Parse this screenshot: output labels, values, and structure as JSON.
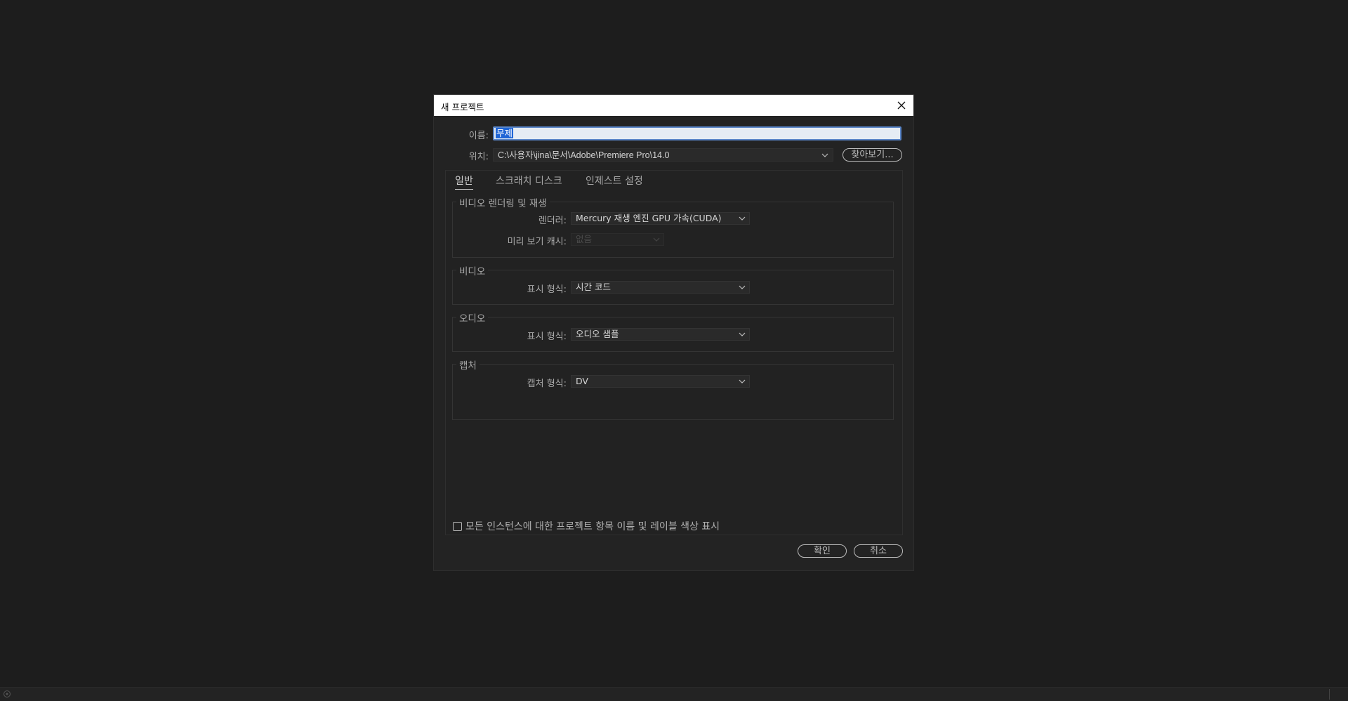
{
  "dialog": {
    "title": "새 프로젝트",
    "name_label": "이름:",
    "name_value": "무제",
    "location_label": "위치:",
    "location_value": "C:\\사용자\\jina\\문서\\Adobe\\Premiere Pro\\14.0",
    "browse_label": "찾아보기...",
    "ok_label": "확인",
    "cancel_label": "취소"
  },
  "tabs": [
    {
      "label": "일반",
      "active": true
    },
    {
      "label": "스크래치 디스크",
      "active": false
    },
    {
      "label": "인제스트 설정",
      "active": false
    }
  ],
  "groups": {
    "rendering": {
      "title": "비디오 렌더링 및 재생",
      "renderer_label": "렌더러:",
      "renderer_value": "Mercury 재생 엔진 GPU 가속(CUDA)",
      "preview_cache_label": "미리 보기 캐시:",
      "preview_cache_value": "없음"
    },
    "video": {
      "title": "비디오",
      "display_format_label": "표시 형식:",
      "display_format_value": "시간 코드"
    },
    "audio": {
      "title": "오디오",
      "display_format_label": "표시 형식:",
      "display_format_value": "오디오 샘플"
    },
    "capture": {
      "title": "캡처",
      "capture_format_label": "캡처 형식:",
      "capture_format_value": "DV"
    }
  },
  "checkbox": {
    "label": "모든 인스턴스에 대한 프로젝트 항목 이름 및 레이블 색상 표시",
    "checked": false
  },
  "colors": {
    "background": "#1d1d1d",
    "dialog": "#232323",
    "selection": "#1f65d6",
    "focus_border": "#5a86c9"
  }
}
